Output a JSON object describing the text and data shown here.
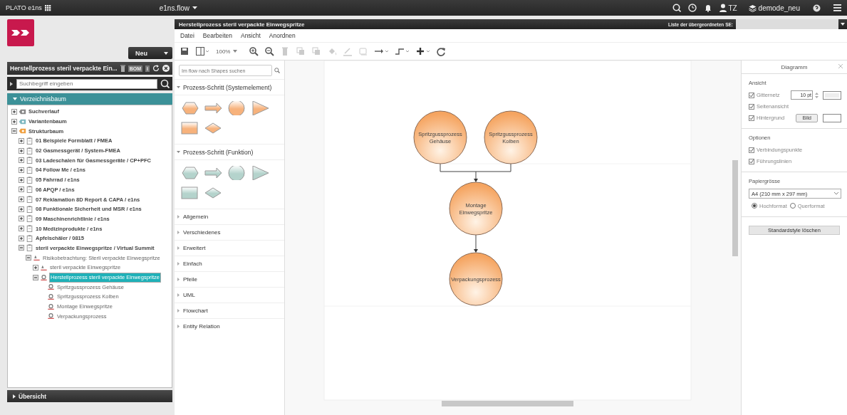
{
  "top_bar": {
    "app_name": "PLATO e1ns",
    "module": "e1ns.flow",
    "user": "TZ",
    "workspace": "demode_neu"
  },
  "left_panel": {
    "new_button": "Neu",
    "object_title": "Herstellprozess steril verpackte Ein...",
    "badge": "BOM",
    "info": "i",
    "search": {
      "placeholder": "Suchbegriff eingeben"
    },
    "tree_header": "Verzeichnisbaum",
    "tree": [
      {
        "label": "Suchverlauf",
        "kind": "search",
        "expanded": false,
        "selected": false
      },
      {
        "label": "Variantenbaum",
        "kind": "variant",
        "expanded": false,
        "selected": false
      },
      {
        "label": "Strukturbaum",
        "kind": "structure",
        "expanded": true,
        "selected": false,
        "children": [
          {
            "label": "01 Beispiele Formblatt / FMEA",
            "kind": "doc",
            "expanded": false,
            "selected": false
          },
          {
            "label": "02 Gasmessgerät / System-FMEA",
            "kind": "doc",
            "expanded": false,
            "selected": false
          },
          {
            "label": "03 Ladeschalen für Gasmessgeräte / CP+PFC",
            "kind": "doc",
            "expanded": false,
            "selected": false
          },
          {
            "label": "04 Follow Me / e1ns",
            "kind": "doc",
            "expanded": false,
            "selected": false
          },
          {
            "label": "05 Fahrrad / e1ns",
            "kind": "doc",
            "expanded": false,
            "selected": false
          },
          {
            "label": "06 APQP / e1ns",
            "kind": "doc",
            "expanded": false,
            "selected": false
          },
          {
            "label": "07 Reklamation 8D Report & CAPA / e1ns",
            "kind": "doc",
            "expanded": false,
            "selected": false
          },
          {
            "label": "08 Funktionale Sicherheit und MSR / e1ns",
            "kind": "doc",
            "expanded": false,
            "selected": false
          },
          {
            "label": "09 Maschinenrichtlinie / e1ns",
            "kind": "doc",
            "expanded": false,
            "selected": false
          },
          {
            "label": "10 Medizinprodukte / e1ns",
            "kind": "doc",
            "expanded": false,
            "selected": false
          },
          {
            "label": "Apfelschäler / 0815",
            "kind": "doc",
            "expanded": false,
            "selected": false
          },
          {
            "label": "steril verpackte Einwegspritze / Virtual Summit",
            "kind": "doc",
            "expanded": true,
            "selected": false,
            "children": [
              {
                "label": "Risikobetrachtung: Steril verpackte Einwegspritze",
                "kind": "risk",
                "expanded": true,
                "selected": false,
                "children": [
                  {
                    "label": "steril verpackte Einwegspritze",
                    "kind": "risk",
                    "expanded": false,
                    "selected": false
                  },
                  {
                    "label": "Herstellprozess steril verpackte Einwegspritze",
                    "kind": "process",
                    "expanded": true,
                    "selected": true,
                    "children": [
                      {
                        "label": "Spritzgussprozess Gehäuse",
                        "kind": "process",
                        "selected": false
                      },
                      {
                        "label": "Spritzgussprozess Kolben",
                        "kind": "process",
                        "selected": false
                      },
                      {
                        "label": "Montage Einwegspritze",
                        "kind": "process",
                        "selected": false
                      },
                      {
                        "label": "Verpackungsprozess",
                        "kind": "process",
                        "selected": false
                      }
                    ]
                  }
                ]
              }
            ]
          }
        ]
      }
    ],
    "footer": "Übersicht"
  },
  "editor": {
    "title": "Herstellprozess steril verpackte Einwegspritze",
    "parent_label": "Liste der übergeordneten SE:",
    "menu": [
      "Datei",
      "Bearbeiten",
      "Ansicht",
      "Anordnen"
    ],
    "zoom": "100%",
    "toolbar": [
      {
        "kind": "save",
        "disabled": false
      },
      {
        "kind": "panel",
        "disabled": false
      },
      {
        "kind": "zoom",
        "disabled": false
      },
      {
        "kind": "zoom-in",
        "disabled": false
      },
      {
        "kind": "zoom-out",
        "disabled": false
      },
      {
        "kind": "delete",
        "disabled": true
      },
      {
        "kind": "to-front",
        "disabled": true
      },
      {
        "kind": "to-back",
        "disabled": true
      },
      {
        "kind": "fill",
        "disabled": true
      },
      {
        "kind": "line",
        "disabled": true
      },
      {
        "kind": "shadow",
        "disabled": true
      },
      {
        "kind": "connection",
        "disabled": false
      },
      {
        "kind": "waypoint",
        "disabled": false
      },
      {
        "kind": "insert",
        "disabled": false
      },
      {
        "kind": "redo",
        "disabled": false
      }
    ]
  },
  "shapes_panel": {
    "search": {
      "placeholder": "Im flow nach Shapes suchen"
    },
    "sections": [
      {
        "title": "Prozess-Schritt (Systemelement)",
        "expanded": true,
        "color": "#f7b27c",
        "shapes": [
          {
            "kind": "hexagon"
          },
          {
            "kind": "arrow"
          },
          {
            "kind": "circle"
          },
          {
            "kind": "triangle"
          },
          {
            "kind": "rectangle"
          },
          {
            "kind": "diamond"
          }
        ]
      },
      {
        "title": "Prozess-Schritt (Funktion)",
        "expanded": true,
        "color": "#b4d3cc",
        "shapes": [
          {
            "kind": "hexagon"
          },
          {
            "kind": "arrow"
          },
          {
            "kind": "circle"
          },
          {
            "kind": "triangle"
          },
          {
            "kind": "rectangle"
          },
          {
            "kind": "diamond"
          }
        ]
      },
      {
        "title": "Allgemein",
        "expanded": false
      },
      {
        "title": "Verschiedenes",
        "expanded": false
      },
      {
        "title": "Erweitert",
        "expanded": false
      },
      {
        "title": "Einfach",
        "expanded": false
      },
      {
        "title": "Pfeile",
        "expanded": false
      },
      {
        "title": "UML",
        "expanded": false
      },
      {
        "title": "Flowchart",
        "expanded": false
      },
      {
        "title": "Entity Relation",
        "expanded": false
      }
    ]
  },
  "diagram": {
    "nodes": [
      {
        "label": "Spritzgussprozess Gehäuse"
      },
      {
        "label": "Spritzgussprozess Kolben"
      },
      {
        "label": "Montage Einwegspritze"
      },
      {
        "label": "Verpackungsprozess"
      }
    ]
  },
  "format_panel": {
    "title": "Diagramm",
    "view": {
      "title": "Ansicht",
      "grid": {
        "label": "Gitternetz",
        "checked": true,
        "value": "10 pt"
      },
      "page_view": {
        "label": "Seitenansicht",
        "checked": true
      },
      "background": {
        "label": "Hintergrund",
        "checked": true,
        "button": "Bild"
      }
    },
    "options": {
      "title": "Optionen",
      "items": [
        {
          "label": "Verbindungspunkte",
          "checked": true
        },
        {
          "label": "Führungslinien",
          "checked": true
        }
      ]
    },
    "paper": {
      "title": "Papiergrösse",
      "value": "A4 (210 mm x 297 mm)",
      "orientations": [
        {
          "label": "Hochformat",
          "selected": true
        },
        {
          "label": "Querformat",
          "selected": false
        }
      ]
    },
    "reset_button": "Standardstyle löschen"
  }
}
